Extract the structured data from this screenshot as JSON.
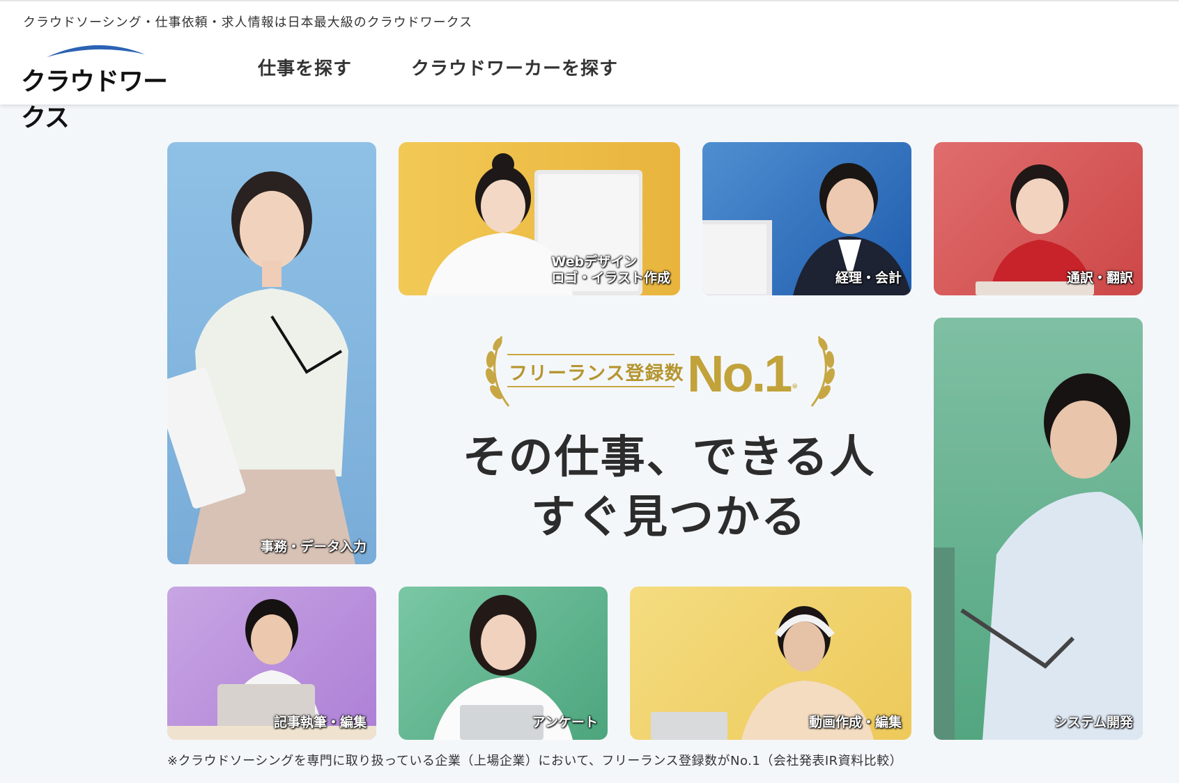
{
  "header": {
    "tagline": "クラウドソーシング・仕事依頼・求人情報は日本最大級のクラウドワークス",
    "logo_text": "クラウドワークス",
    "nav": [
      "仕事を探す",
      "クラウドワーカーを探す"
    ]
  },
  "badge": {
    "label": "フリーランス登録数",
    "rank": "No.1",
    "note_mark": "※"
  },
  "headline": {
    "line1": "その仕事、できる人",
    "line2": "すぐ見つかる"
  },
  "categories": [
    {
      "label": "事務・データ入力",
      "color": "#7fb3dc"
    },
    {
      "label_line1": "Webデザイン",
      "label_line2": "ロゴ・イラスト作成",
      "color": "#efc04a"
    },
    {
      "label": "経理・会計",
      "color": "#2f6fc0"
    },
    {
      "label": "通訳・翻訳",
      "color": "#d65a5a"
    },
    {
      "label": "システム開発",
      "color": "#5aa98a"
    },
    {
      "label": "記事執筆・編集",
      "color": "#b98ad9"
    },
    {
      "label": "アンケート",
      "color": "#5aae8a"
    },
    {
      "label": "動画作成・編集",
      "color": "#f1d66e"
    }
  ],
  "footnote": "※クラウドソーシングを専門に取り扱っている企業（上場企業）において、フリーランス登録数がNo.1（会社発表IR資料比較）"
}
